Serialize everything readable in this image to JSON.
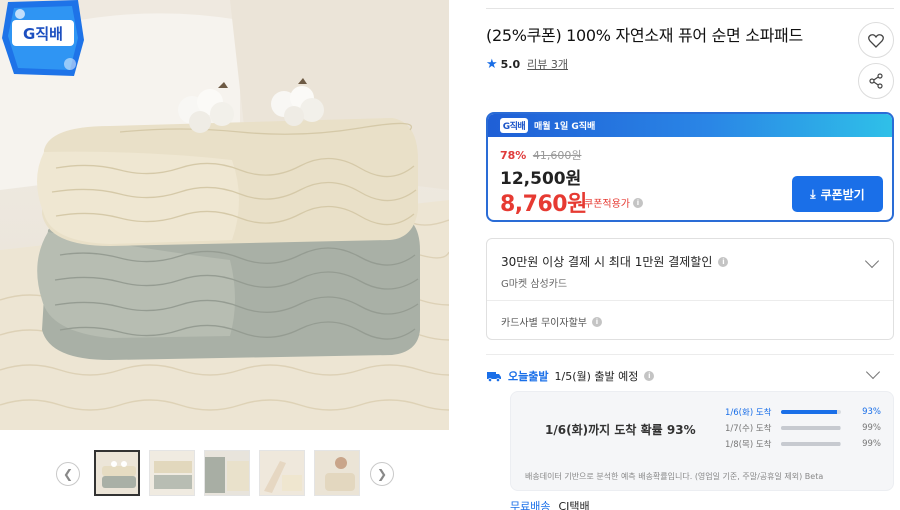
{
  "gallery": {
    "shipping_badge": "G직배",
    "prev_icon": "chevron-left-icon",
    "next_icon": "chevron-right-icon",
    "thumbnail_count": 5,
    "active_thumbnail": 1
  },
  "product": {
    "title": "(25%쿠폰) 100% 자연소재 퓨어 순면 소파패드",
    "rating": "5.0",
    "review_label": "리뷰 3개",
    "wishlist_icon": "heart-icon",
    "share_icon": "share-icon"
  },
  "price_card": {
    "header_badge": "G직배",
    "header_text": "매월 1일 G직배",
    "discount_rate": "78%",
    "original_price": "41,600원",
    "sale_price": "12,500원",
    "coupon_price": "8,760원",
    "coupon_label": "쿠폰적용가",
    "coupon_button": "쿠폰받기",
    "accent_color": "#1a6fe8",
    "price_color": "#e63a32"
  },
  "card_discount": {
    "headline": "30만원 이상 결제 시 최대 1만원 결제할인",
    "card_name": "G마켓 삼성카드",
    "installment": "카드사별 무이자할부"
  },
  "delivery": {
    "today_label": "오늘출발",
    "ship_date": "1/5(월) 출발 예정",
    "probability_text": "1/6(화)까지 도착 확률 93%",
    "rows": [
      {
        "date": "1/6(화) 도착",
        "percent": "93%",
        "value": 93
      },
      {
        "date": "1/7(수) 도착",
        "percent": "99%",
        "value": 99
      },
      {
        "date": "1/8(목) 도착",
        "percent": "99%",
        "value": 99
      }
    ],
    "note": "배송데이터 기반으로 분석한 예측 배송확률입니다. (영업일 기준, 주말/공휴일 제외) Beta",
    "free_shipping": "무료배송",
    "carrier": "CJ택배"
  }
}
